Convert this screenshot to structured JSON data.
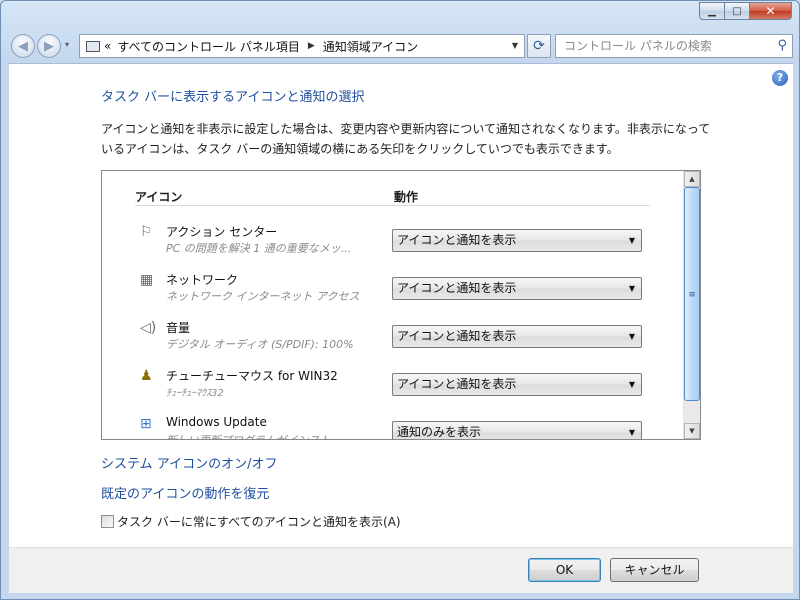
{
  "window": {
    "caption": {
      "minimize": "▁",
      "maximize": "□",
      "close": "✕"
    }
  },
  "navbar": {
    "back_glyph": "◀",
    "forward_glyph": "▶",
    "history_glyph": "▾",
    "address": {
      "prefix": "«",
      "crumbs": [
        "すべてのコントロール パネル項目",
        "通知領域アイコン"
      ],
      "separator": "▶",
      "dropdown_glyph": "▼"
    },
    "refresh_glyph": "⟳",
    "search": {
      "placeholder": "コントロール パネルの検索",
      "icon": "search-icon"
    }
  },
  "content": {
    "help_glyph": "?",
    "title": "タスク バーに表示するアイコンと通知の選択",
    "description": "アイコンと通知を非表示に設定した場合は、変更内容や更新内容について通知されなくなります。非表示になっているアイコンは、タスク バーの通知領域の横にある矢印をクリックしていつでも表示できます。",
    "table": {
      "col_icon": "アイコン",
      "col_action": "動作",
      "rows": [
        {
          "name": "アクション センター",
          "sub": "PC の問題を解決 1 通の重要なメッ...",
          "action": "アイコンと通知を表示",
          "icon": "flag-icon"
        },
        {
          "name": "ネットワーク",
          "sub": "ネットワーク インターネット アクセス",
          "action": "アイコンと通知を表示",
          "icon": "network-icon"
        },
        {
          "name": "音量",
          "sub": "デジタル オーディオ (S/PDIF): 100%",
          "action": "アイコンと通知を表示",
          "icon": "speaker-icon"
        },
        {
          "name": "チューチューマウス for WIN32",
          "sub": "ﾁｭｰﾁｭｰﾏｳｽ32",
          "action": "アイコンと通知を表示",
          "icon": "mouse-icon"
        },
        {
          "name": "Windows Update",
          "sub": "新しい更新プログラムがインスト...",
          "action": "通知のみを表示",
          "icon": "windows-update-icon"
        }
      ],
      "select_arrow": "▼",
      "scroll_up": "▲",
      "scroll_down": "▼",
      "scroll_grip": "≡"
    },
    "link_system_icons": "システム アイコンのオン/オフ",
    "link_restore": "既定のアイコンの動作を復元",
    "checkbox_label": "タスク バーに常にすべてのアイコンと通知を表示(A)",
    "checkbox_checked": false
  },
  "footer": {
    "ok": "OK",
    "cancel": "キャンセル"
  }
}
